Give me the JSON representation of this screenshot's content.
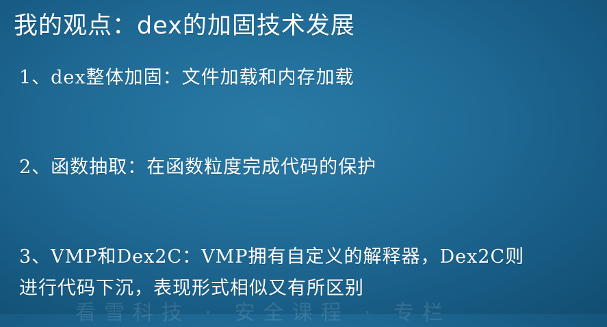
{
  "slide": {
    "title": "我的观点：dex的加固技术发展",
    "items": [
      {
        "text": "1、dex整体加固：文件加载和内存加载"
      },
      {
        "text": "2、函数抽取：在函数粒度完成代码的保护"
      },
      {
        "line1": "3、VMP和Dex2C：VMP拥有自定义的解释器，Dex2C则",
        "line2": "进行代码下沉，表现形式相似又有所区别"
      }
    ],
    "watermark": "看雪科技 · 安全课程 · 专栏"
  },
  "colors": {
    "background": "#1f6a95",
    "text": "#ffffff"
  }
}
